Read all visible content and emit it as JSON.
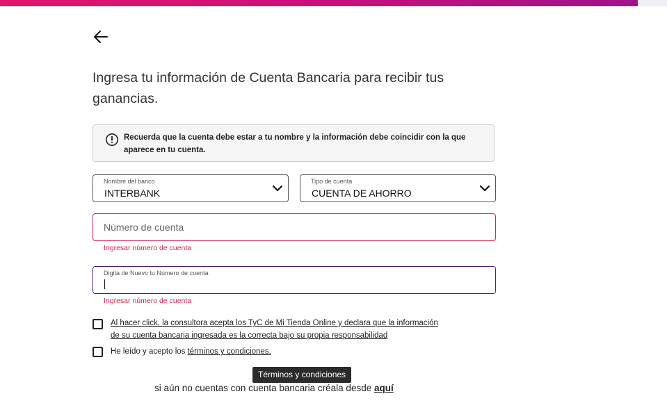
{
  "header": {
    "accent_gradient": [
      "#e0176a",
      "#a0128a"
    ]
  },
  "back_icon": "arrow-left-icon",
  "heading": "Ingresa tu información de Cuenta Bancaria para recibir tus ganancias.",
  "notice": {
    "icon": "info-circle-icon",
    "text": "Recuerda que la cuenta debe estar a tu nombre y la información debe coincidir con la que aparece en tu cuenta."
  },
  "bank_select": {
    "label": "Nombre del banco",
    "value": "INTERBANK"
  },
  "account_type_select": {
    "label": "Tipo de cuenta",
    "value": "CUENTA DE AHORRO"
  },
  "account_number": {
    "placeholder": "Número de cuenta",
    "error": "Ingresar número de cuenta"
  },
  "account_number_confirm": {
    "label": "Digita de Nuevo tu Número de cuenta",
    "value": "",
    "error": "Ingresar número de cuenta"
  },
  "consent_1": {
    "line1": "Al hacer click, la consultora acepta los TyC de Mi Tienda Online y declara que la información",
    "line2": "de su cuenta bancaria ingresada es la correcta bajo su propia responsabilidad"
  },
  "consent_2": {
    "prefix": "He leído y acepto los ",
    "link": "términos y condiciones."
  },
  "tooltip": "Términos y condiciones",
  "footer": {
    "text": "si aún no cuentas con cuenta bancaria créala desde ",
    "link": "aquí"
  },
  "colors": {
    "error": "#d1284f",
    "focus": "#4a2170"
  }
}
